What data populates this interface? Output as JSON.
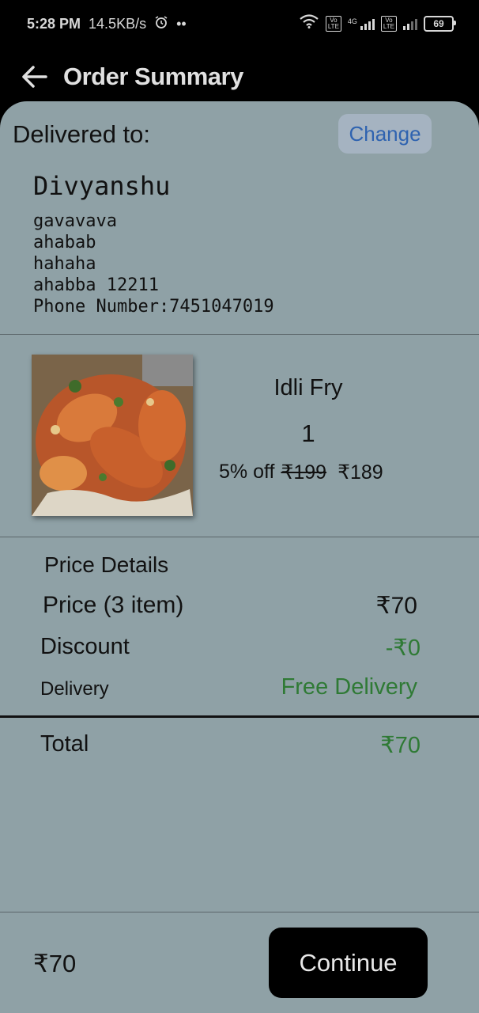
{
  "status_bar": {
    "time": "5:28 PM",
    "speed": "14.5KB/s",
    "dots": "••",
    "network_1": "4G",
    "battery": "69"
  },
  "app_bar": {
    "title": "Order Summary"
  },
  "address": {
    "label": "Delivered to:",
    "change_label": "Change",
    "name": "Divyanshu",
    "lines": [
      "gavavava",
      "ahabab",
      "hahaha",
      "ahabba 12211",
      "Phone Number:7451047019"
    ]
  },
  "product": {
    "name": "Idli Fry",
    "quantity": "1",
    "discount": "5% off",
    "mrp": "₹199",
    "price": "₹189"
  },
  "price_details": {
    "title": "Price Details",
    "price_label": "Price (3 item)",
    "price_value": "₹70",
    "discount_label": "Discount",
    "discount_value": "-₹0",
    "delivery_label": "Delivery",
    "delivery_value": "Free Delivery",
    "total_label": "Total",
    "total_value": "₹70"
  },
  "bottom_bar": {
    "total": "₹70",
    "continue_label": "Continue"
  },
  "colors": {
    "sheet": "#8fa1a6",
    "accent_green": "#2f7a35",
    "change_blue": "#2f63b0"
  }
}
